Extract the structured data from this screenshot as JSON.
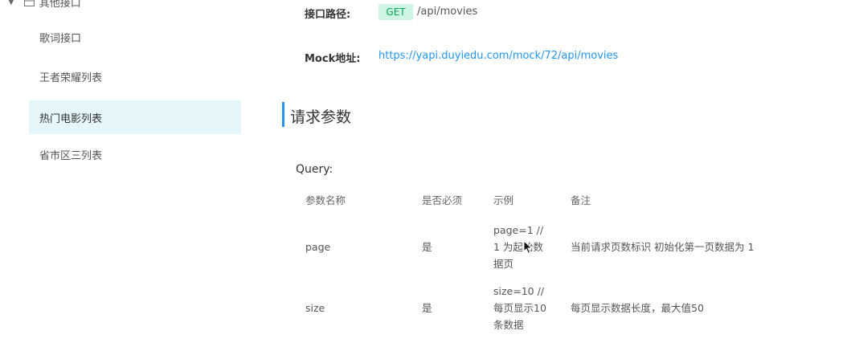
{
  "sidebar": {
    "parent_label": "其他接口",
    "items": [
      {
        "label": "歌词接口"
      },
      {
        "label": "王者荣耀列表"
      },
      {
        "label": "热门电影列表"
      },
      {
        "label": "省市区三列表"
      }
    ]
  },
  "info": {
    "path_label": "接口路径:",
    "method": "GET",
    "path": "/api/movies",
    "mock_label": "Mock地址:",
    "mock_url": "https://yapi.duyiedu.com/mock/72/api/movies"
  },
  "section_title": "请求参数",
  "query": {
    "label": "Query:",
    "headers": [
      "参数名称",
      "是否必须",
      "示例",
      "备注"
    ],
    "rows": [
      {
        "name": "page",
        "required": "是",
        "example": [
          "page=1   //",
          "1 为起始数",
          "据页"
        ],
        "note": "当前请求页数标识   初始化第一页数据为 1"
      },
      {
        "name": "size",
        "required": "是",
        "example": [
          "size=10   //",
          "每页显示10",
          "条数据"
        ],
        "note": "每页显示数据长度，最大值50"
      }
    ]
  },
  "colors": {
    "accent": "#2395f1",
    "get_badge_bg": "#cff5e5",
    "get_badge_text": "#00a854",
    "active_bg": "#e6f7fc"
  }
}
